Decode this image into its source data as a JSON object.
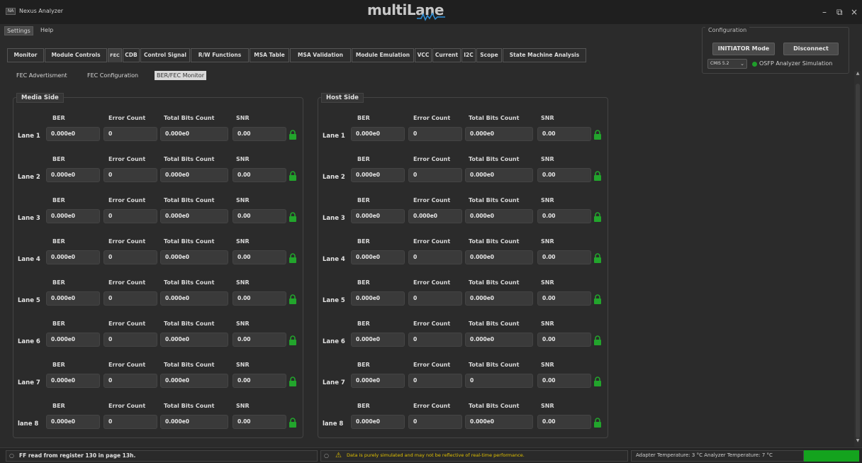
{
  "window": {
    "title": "Nexus Analyzer",
    "icon_text": "NA",
    "brand": "multiLane",
    "controls": [
      "–",
      "⧉",
      "×"
    ]
  },
  "menu": [
    "Settings",
    "Help"
  ],
  "configuration": {
    "title": "Configuration",
    "initiator_button": "INITIATOR Mode",
    "disconnect_button": "Disconnect",
    "cmis_value": "CMIS 5.2",
    "simulation_label": "OSFP Analyzer Simulation",
    "led_color": "#1f9d2a"
  },
  "tabs": [
    "Monitor",
    "Module Controls",
    "FEC",
    "CDB",
    "Control Signal",
    "R/W Functions",
    "MSA Table",
    "MSA Validation",
    "Module Emulation",
    "VCC",
    "Current",
    "I2C",
    "Scope",
    "State Machine Analysis"
  ],
  "active_tab": "FEC",
  "subtabs": [
    "FEC Advertisment",
    "FEC Configuration",
    "BER/FEC Monitor"
  ],
  "active_subtab": "BER/FEC Monitor",
  "headers": {
    "ber": "BER",
    "error_count": "Error Count",
    "total_bits": "Total Bits Count",
    "snr": "SNR"
  },
  "media": {
    "title": "Media Side",
    "lanes": [
      {
        "label": "Lane 1",
        "ber": "0.000e0",
        "errors": "0",
        "total_bits": "0.000e0",
        "snr": "0.00"
      },
      {
        "label": "Lane 2",
        "ber": "0.000e0",
        "errors": "0",
        "total_bits": "0.000e0",
        "snr": "0.00"
      },
      {
        "label": "Lane 3",
        "ber": "0.000e0",
        "errors": "0",
        "total_bits": "0.000e0",
        "snr": "0.00"
      },
      {
        "label": "Lane 4",
        "ber": "0.000e0",
        "errors": "0",
        "total_bits": "0.000e0",
        "snr": "0.00"
      },
      {
        "label": "Lane 5",
        "ber": "0.000e0",
        "errors": "0",
        "total_bits": "0.000e0",
        "snr": "0.00"
      },
      {
        "label": "Lane 6",
        "ber": "0.000e0",
        "errors": "0",
        "total_bits": "0.000e0",
        "snr": "0.00"
      },
      {
        "label": "Lane 7",
        "ber": "0.000e0",
        "errors": "0",
        "total_bits": "0.000e0",
        "snr": "0.00"
      },
      {
        "label": "lane 8",
        "ber": "0.000e0",
        "errors": "0",
        "total_bits": "0.000e0",
        "snr": "0.00"
      }
    ]
  },
  "host": {
    "title": "Host Side",
    "lanes": [
      {
        "label": "Lane 1",
        "ber": "0.000e0",
        "errors": "0",
        "total_bits": "0.000e0",
        "snr": "0.00"
      },
      {
        "label": "Lane 2",
        "ber": "0.000e0",
        "errors": "0",
        "total_bits": "0.000e0",
        "snr": "0.00"
      },
      {
        "label": "Lane 3",
        "ber": "0.000e0",
        "errors": "0.000e0",
        "total_bits": "0.000e0",
        "snr": "0.00"
      },
      {
        "label": "Lane 4",
        "ber": "0.000e0",
        "errors": "0",
        "total_bits": "0.000e0",
        "snr": "0.00"
      },
      {
        "label": "Lane 5",
        "ber": "0.000e0",
        "errors": "0",
        "total_bits": "0.000e0",
        "snr": "0.00"
      },
      {
        "label": "Lane 6",
        "ber": "0.000e0",
        "errors": "0",
        "total_bits": "0.000e0",
        "snr": "0.00"
      },
      {
        "label": "Lane 7",
        "ber": "0.000e0",
        "errors": "0",
        "total_bits": "0",
        "snr": "0.00"
      },
      {
        "label": "lane 8",
        "ber": "0.000e0",
        "errors": "0",
        "total_bits": "0.000e0",
        "snr": "0.00"
      }
    ]
  },
  "lock_color": "#22a52c",
  "status": {
    "left": "FF read from register 130 in page 13h.",
    "warning": "Data is purely simulated and may not be reflective of real-time performance.",
    "temperature": "Adapter Temperature: 3 °C  Analyzer Temperature: 7 °C",
    "warning_color": "#e0c000",
    "temp_bar_color": "#14a31e"
  }
}
